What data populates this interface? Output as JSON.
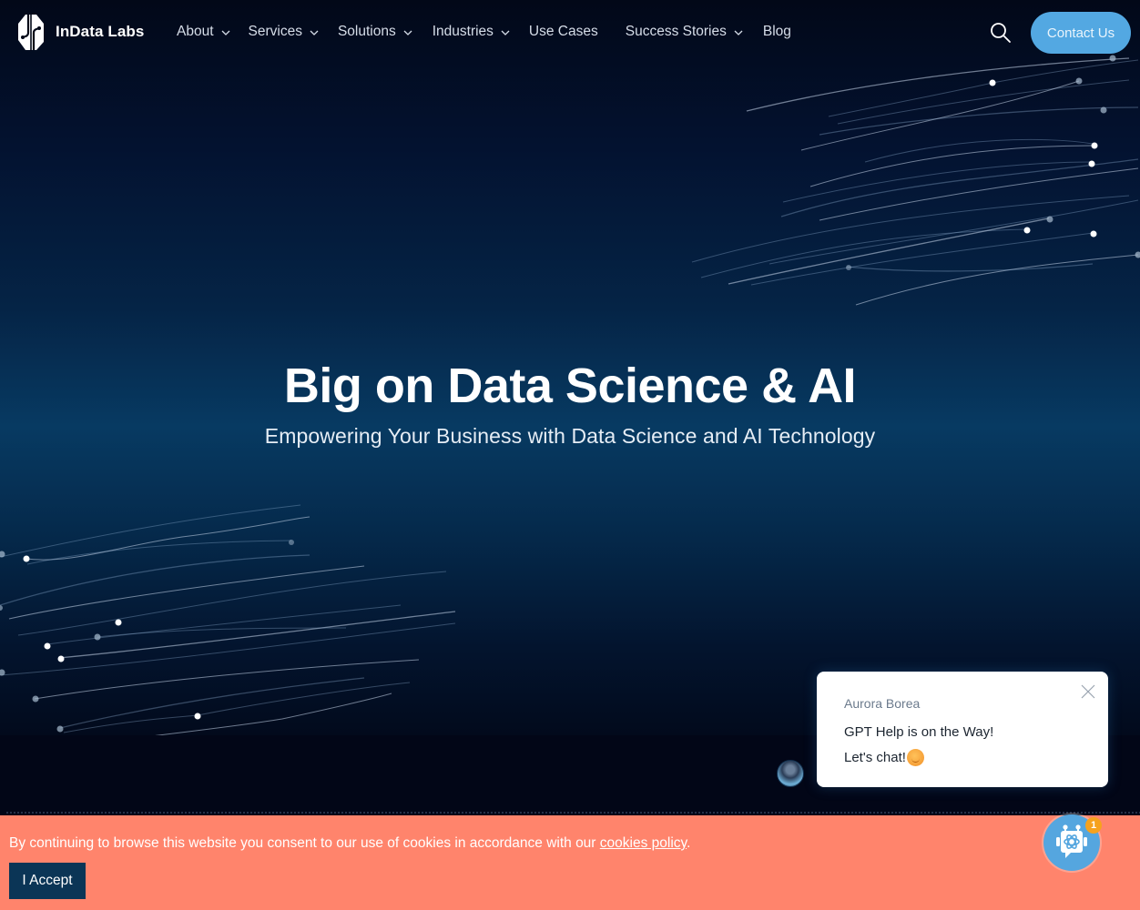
{
  "header": {
    "brand": "InData Labs",
    "nav": [
      {
        "label": "About",
        "has_dropdown": true
      },
      {
        "label": "Services",
        "has_dropdown": true
      },
      {
        "label": "Solutions",
        "has_dropdown": true
      },
      {
        "label": "Industries",
        "has_dropdown": true
      },
      {
        "label": "Use Cases",
        "has_dropdown": false
      },
      {
        "label": "Success Stories",
        "has_dropdown": true
      },
      {
        "label": "Blog",
        "has_dropdown": false
      }
    ],
    "search_icon": "search-icon",
    "contact_label": "Contact Us"
  },
  "hero": {
    "title": "Big on Data Science & AI",
    "subtitle": "Empowering Your Business with Data Science and AI Technology"
  },
  "chat": {
    "sender": "Aurora Borea",
    "line1": "GPT Help is on the Way!",
    "line2": "Let's chat!",
    "emoji": "smiling-face-emoji",
    "unread_count": "1"
  },
  "cookie": {
    "text": "By continuing to browse this website you consent to our use of cookies in accordance with our ",
    "link": "cookies policy",
    "suffix": ".",
    "accept_label": "I Accept"
  },
  "colors": {
    "accent": "#53a8e2",
    "cookie_bg": "#ff846c",
    "accept_bg": "#0b3556",
    "badge": "#f6a21d",
    "hero_top": "#020818",
    "hero_mid": "#073a62"
  }
}
